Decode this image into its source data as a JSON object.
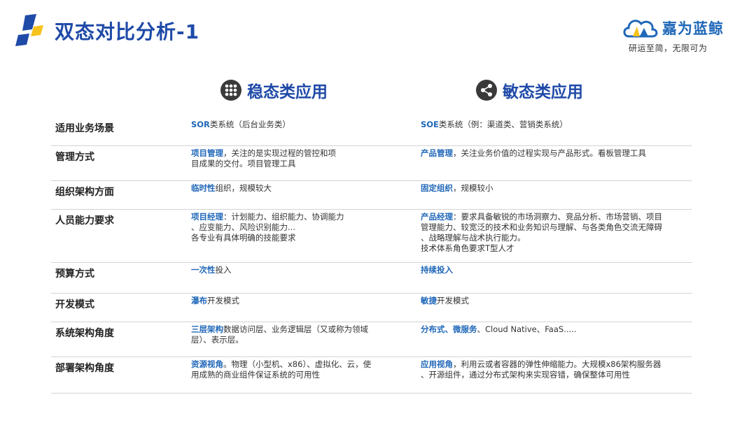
{
  "header": {
    "title": "双态对比分析-1",
    "brand_name": "嘉为蓝鲸",
    "slogan": "研运至简，无限可为"
  },
  "columns": {
    "left": "稳态类应用",
    "right": "敏态类应用"
  },
  "rows": [
    {
      "label": "适用业务场景",
      "c1_lines": [
        [
          {
            "t": "SOR",
            "k": true
          },
          {
            "t": "类系统（后台业务类）",
            "k": false
          }
        ]
      ],
      "c2_lines": [
        [
          {
            "t": "SOE",
            "k": true
          },
          {
            "t": "类系统（例：渠道类、营销类系统）",
            "k": false
          }
        ]
      ]
    },
    {
      "label": "管理方式",
      "c1_lines": [
        [
          {
            "t": "项目管理",
            "k": true
          },
          {
            "t": "，关注的是实现过程的管控和项",
            "k": false
          }
        ],
        [
          {
            "t": "目成果的交付。项目管理工具",
            "k": false
          }
        ]
      ],
      "c2_lines": [
        [
          {
            "t": "产品管理",
            "k": true
          },
          {
            "t": "，关注业务价值的过程实现与产品形式。看板管理工具",
            "k": false
          }
        ]
      ]
    },
    {
      "label": "组织架构方面",
      "c1_lines": [
        [
          {
            "t": "临时性",
            "k": true
          },
          {
            "t": "组织，规模较大",
            "k": false
          }
        ]
      ],
      "c2_lines": [
        [
          {
            "t": "固定组织",
            "k": true
          },
          {
            "t": "，规模较小",
            "k": false
          }
        ]
      ]
    },
    {
      "label": "人员能力要求",
      "c1_lines": [
        [
          {
            "t": "项目经理",
            "k": true
          },
          {
            "t": "：计划能力、组织能力、协调能力",
            "k": false
          }
        ],
        [
          {
            "t": "、应变能力、风险识别能力...",
            "k": false
          }
        ],
        [
          {
            "t": "各专业有具体明确的技能要求",
            "k": false
          }
        ]
      ],
      "c2_lines": [
        [
          {
            "t": "产品经理",
            "k": true
          },
          {
            "t": "：要求具备敏锐的市场洞察力、竞品分析、市场营销、项目",
            "k": false
          }
        ],
        [
          {
            "t": "管理能力、较宽泛的技术和业务知识与理解、与各类角色交流无障碍",
            "k": false
          }
        ],
        [
          {
            "t": "、战略理解与战术执行能力。",
            "k": false
          }
        ],
        [
          {
            "t": "技术体系角色要求T型人才",
            "k": false
          }
        ]
      ]
    },
    {
      "label": "预算方式",
      "c1_lines": [
        [
          {
            "t": "一次性",
            "k": true
          },
          {
            "t": "投入",
            "k": false
          }
        ]
      ],
      "c2_lines": [
        [
          {
            "t": "持续投入",
            "k": true
          }
        ]
      ]
    },
    {
      "label": "开发模式",
      "c1_lines": [
        [
          {
            "t": "瀑布",
            "k": true
          },
          {
            "t": "开发模式",
            "k": false
          }
        ]
      ],
      "c2_lines": [
        [
          {
            "t": "敏捷",
            "k": true
          },
          {
            "t": "开发模式",
            "k": false
          }
        ]
      ]
    },
    {
      "label": "系统架构角度",
      "c1_lines": [
        [
          {
            "t": "三层架构",
            "k": true
          },
          {
            "t": "数据访问层、业务逻辑层（又或称为领域",
            "k": false
          }
        ],
        [
          {
            "t": "层）、表示层。",
            "k": false
          }
        ]
      ],
      "c2_lines": [
        [
          {
            "t": "分布式、微服务",
            "k": true
          },
          {
            "t": "、Cloud Native、FaaS.....",
            "k": false
          }
        ]
      ]
    },
    {
      "label": "部署架构角度",
      "c1_lines": [
        [
          {
            "t": "资源视角",
            "k": true
          },
          {
            "t": "。物理（小型机、x86）、虚拟化、云，使",
            "k": false
          }
        ],
        [
          {
            "t": "用成熟的商业组件保证系统的可用性",
            "k": false
          }
        ]
      ],
      "c2_lines": [
        [
          {
            "t": "应用视角",
            "k": true
          },
          {
            "t": "，利用云或者容器的弹性伸缩能力。大规模x86架构服务器",
            "k": false
          }
        ],
        [
          {
            "t": "、开源组件，通过分布式架构来实现容错，确保整体可用性",
            "k": false
          }
        ]
      ]
    }
  ]
}
